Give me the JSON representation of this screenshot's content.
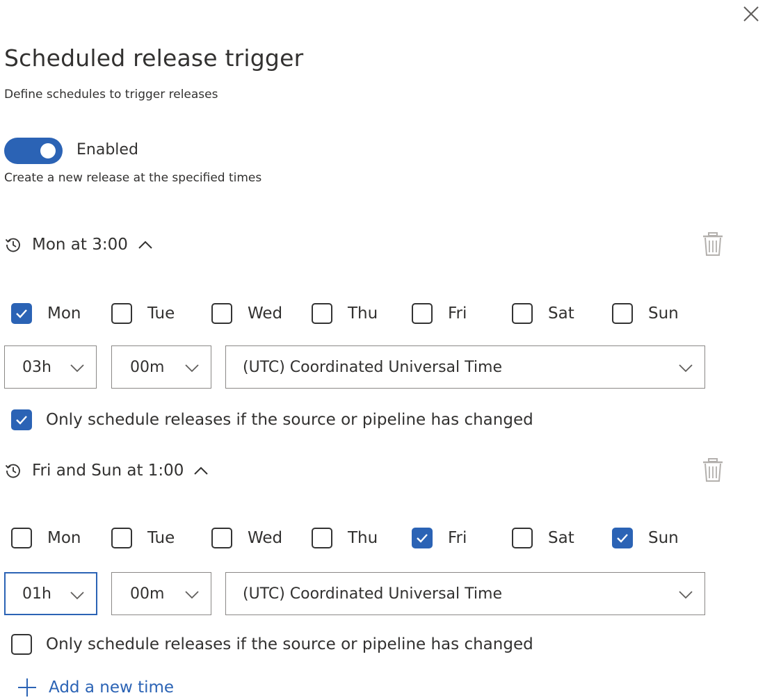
{
  "panel": {
    "title": "Scheduled release trigger",
    "subtitle": "Define schedules to trigger releases",
    "toggle": {
      "label": "Enabled",
      "on": true,
      "description": "Create a new release at the specified times"
    }
  },
  "schedules": [
    {
      "header": "Mon at 3:00",
      "days": [
        {
          "label": "Mon",
          "checked": true
        },
        {
          "label": "Tue",
          "checked": false
        },
        {
          "label": "Wed",
          "checked": false
        },
        {
          "label": "Thu",
          "checked": false
        },
        {
          "label": "Fri",
          "checked": false
        },
        {
          "label": "Sat",
          "checked": false
        },
        {
          "label": "Sun",
          "checked": false
        }
      ],
      "hour": "03h",
      "minute": "00m",
      "timezone": "(UTC) Coordinated Universal Time",
      "only_if_changed": {
        "label": "Only schedule releases if the source or pipeline has changed",
        "checked": true
      }
    },
    {
      "header": "Fri and Sun at 1:00",
      "days": [
        {
          "label": "Mon",
          "checked": false
        },
        {
          "label": "Tue",
          "checked": false
        },
        {
          "label": "Wed",
          "checked": false
        },
        {
          "label": "Thu",
          "checked": false
        },
        {
          "label": "Fri",
          "checked": true
        },
        {
          "label": "Sat",
          "checked": false
        },
        {
          "label": "Sun",
          "checked": true
        }
      ],
      "hour": "01h",
      "minute": "00m",
      "timezone": "(UTC) Coordinated Universal Time",
      "only_if_changed": {
        "label": "Only schedule releases if the source or pipeline has changed",
        "checked": false
      }
    }
  ],
  "add_time_label": "Add a new time",
  "colors": {
    "accent": "#2b63b5",
    "text": "#323130",
    "border": "#8a8886"
  },
  "icons": [
    "close-icon",
    "history-icon",
    "chevron-up-icon",
    "trash-icon",
    "checkmark-icon",
    "chevron-down-icon",
    "plus-icon"
  ]
}
